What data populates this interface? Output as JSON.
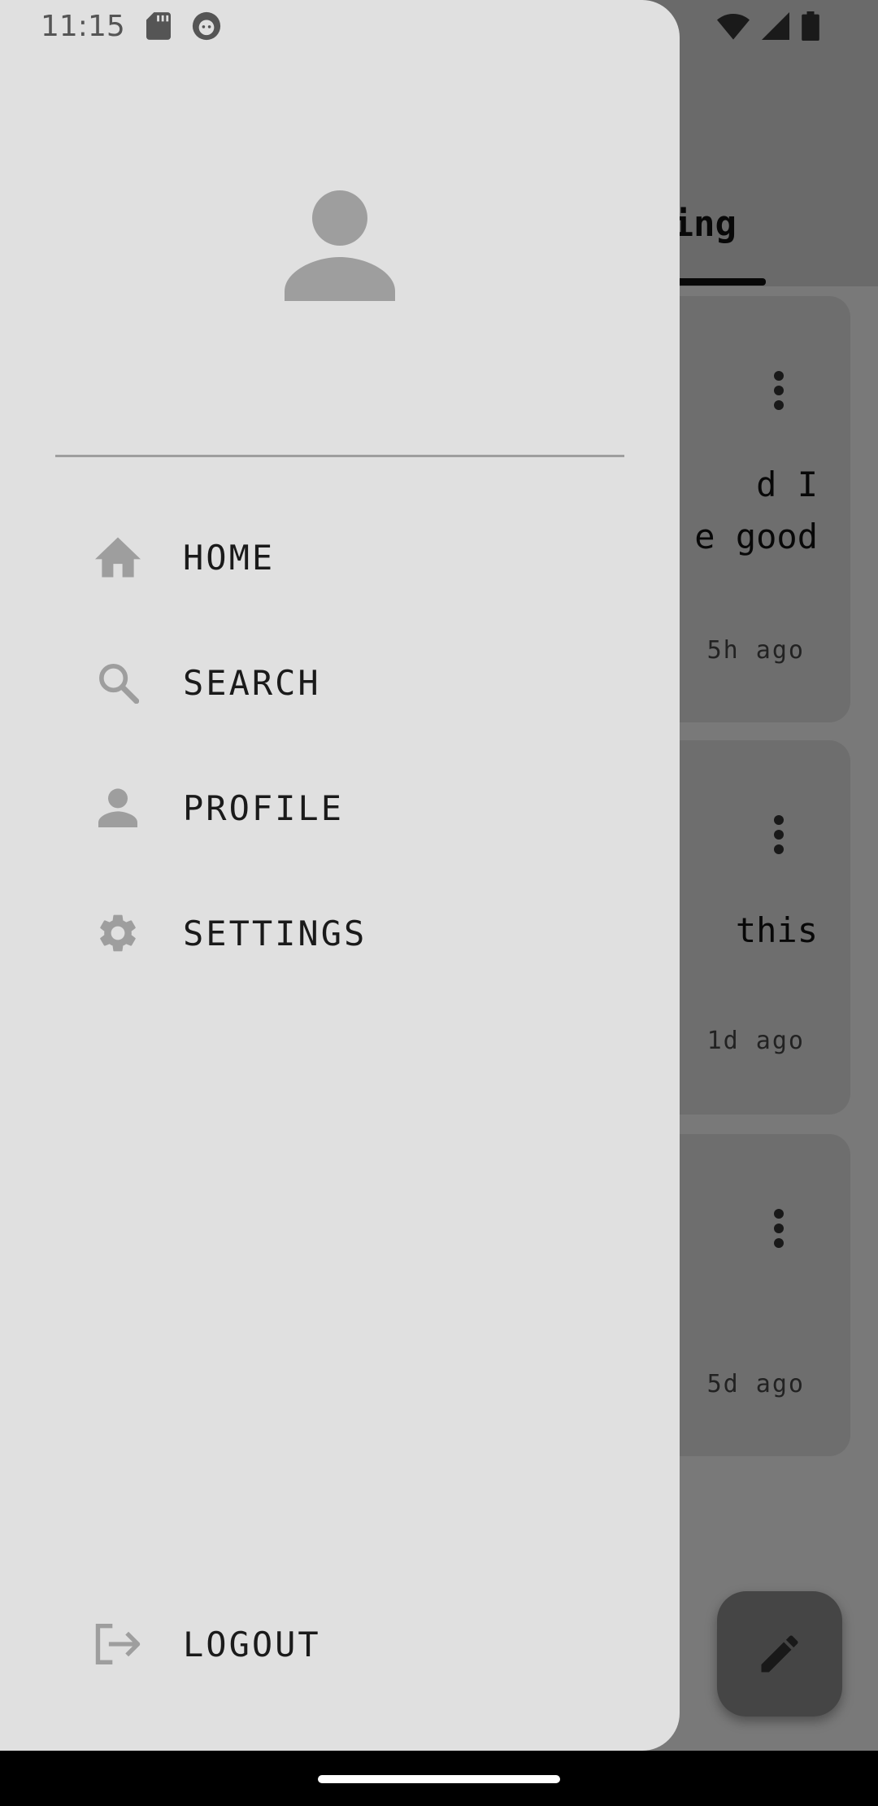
{
  "status_bar": {
    "time": "11:15"
  },
  "background": {
    "tab_label": "wing",
    "posts": [
      {
        "text": "d I\ne good",
        "time": "5h ago"
      },
      {
        "text": "this",
        "time": "1d ago"
      },
      {
        "text": "",
        "time": "5d ago"
      }
    ],
    "fab_icon": "pencil-icon"
  },
  "drawer": {
    "avatar_icon": "person-icon",
    "items": [
      {
        "label": "HOME",
        "icon": "home-icon"
      },
      {
        "label": "SEARCH",
        "icon": "search-icon"
      },
      {
        "label": "PROFILE",
        "icon": "person-icon"
      },
      {
        "label": "SETTINGS",
        "icon": "gear-icon"
      }
    ],
    "logout": {
      "label": "LOGOUT",
      "icon": "logout-icon"
    }
  },
  "colors": {
    "drawer_bg": "#e0e0e0",
    "icon_gray": "#9e9e9e",
    "scrim": "rgba(0,0,0,0.5)"
  }
}
